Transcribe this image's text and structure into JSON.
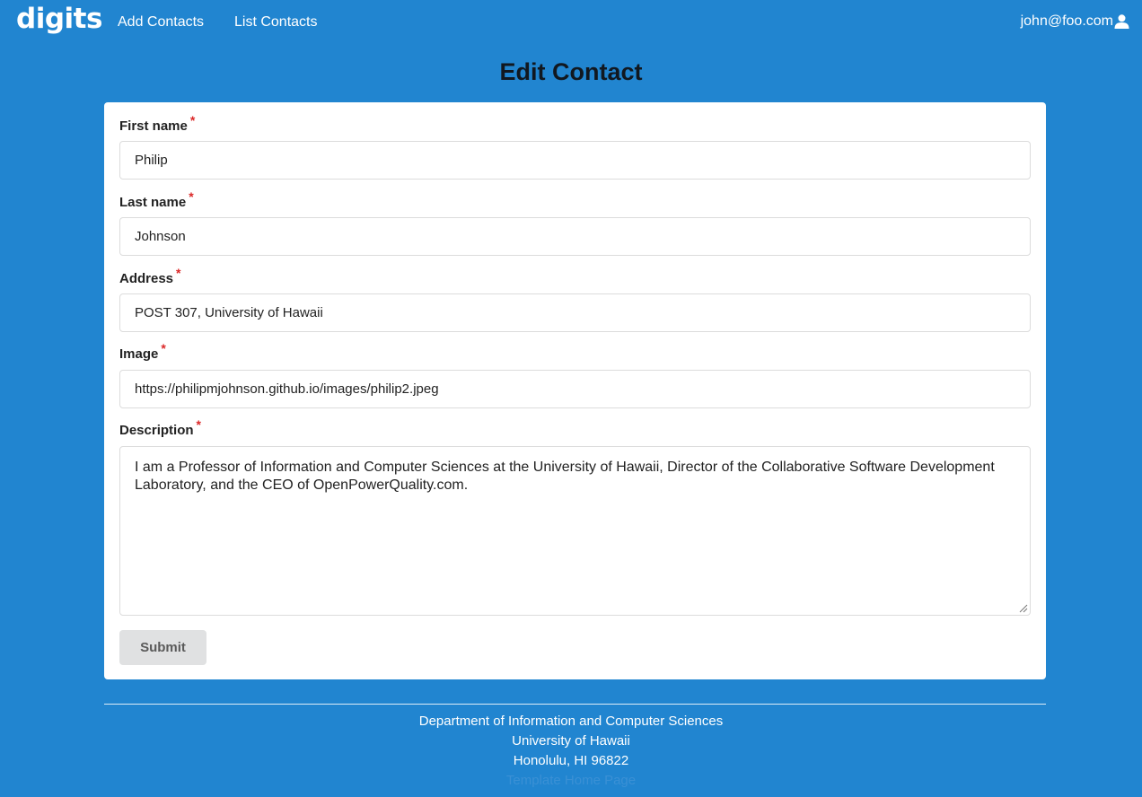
{
  "nav": {
    "brand": "digits",
    "links": [
      "Add Contacts",
      "List Contacts"
    ],
    "user_email": "john@foo.com",
    "user_icon": "user-icon"
  },
  "page": {
    "title": "Edit Contact"
  },
  "form": {
    "required_marker": "*",
    "first_name": {
      "label": "First name",
      "value": "Philip"
    },
    "last_name": {
      "label": "Last name",
      "value": "Johnson"
    },
    "address": {
      "label": "Address",
      "value": "POST 307, University of Hawaii"
    },
    "image": {
      "label": "Image",
      "value": "https://philipmjohnson.github.io/images/philip2.jpeg"
    },
    "description": {
      "label": "Description",
      "value": "I am a Professor of Information and Computer Sciences at the University of Hawaii, Director of the Collaborative Software Development Laboratory, and the CEO of OpenPowerQuality.com."
    },
    "submit_label": "Submit"
  },
  "footer": {
    "lines": [
      "Department of Information and Computer Sciences",
      "University of Hawaii",
      "Honolulu, HI 96822"
    ],
    "link": "Template Home Page"
  },
  "colors": {
    "background": "#2185d0",
    "card": "#ffffff",
    "required": "#db2828",
    "submit_bg": "#e0e1e2"
  }
}
